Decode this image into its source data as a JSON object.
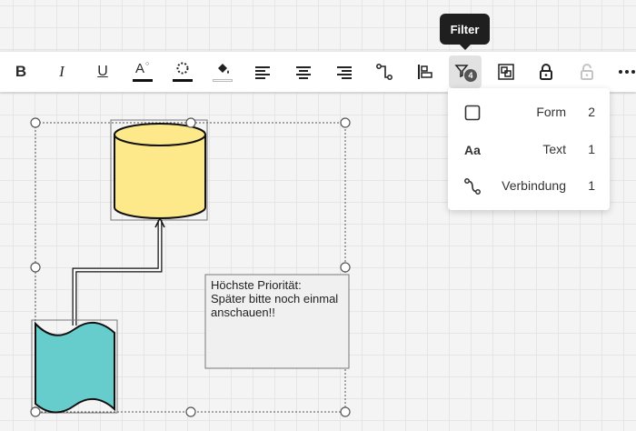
{
  "tooltip": {
    "text": "Filter"
  },
  "toolbar": {
    "buttons": [
      {
        "name": "bold-button",
        "label": "B"
      },
      {
        "name": "italic-button",
        "label": "I"
      },
      {
        "name": "underline-button",
        "label": "U"
      },
      {
        "name": "font-color-button",
        "label": "A"
      },
      {
        "name": "border-color-button",
        "icon": "dotted-circle-icon"
      },
      {
        "name": "fill-color-button",
        "icon": "paint-bucket-icon"
      },
      {
        "name": "align-left-button",
        "icon": "align-left-icon"
      },
      {
        "name": "align-center-button",
        "icon": "align-center-icon"
      },
      {
        "name": "align-right-button",
        "icon": "align-right-icon"
      },
      {
        "name": "connection-style-button",
        "icon": "connector-icon"
      },
      {
        "name": "arrange-button",
        "icon": "align-objects-icon"
      },
      {
        "name": "filter-button",
        "icon": "filter-icon",
        "badge": "4"
      },
      {
        "name": "group-button",
        "icon": "group-icon"
      },
      {
        "name": "lock-button",
        "icon": "lock-icon"
      },
      {
        "name": "unlock-button",
        "icon": "unlock-icon"
      },
      {
        "name": "more-button",
        "icon": "more-icon"
      }
    ]
  },
  "filter_menu": {
    "items": [
      {
        "icon": "square-icon",
        "label": "Form",
        "count": "2"
      },
      {
        "icon": "text-aa-icon",
        "glyph": "Aa",
        "label": "Text",
        "count": "1"
      },
      {
        "icon": "connector-icon",
        "label": "Verbindung",
        "count": "1"
      }
    ]
  },
  "note": {
    "text": "Höchste Priorität:\nSpäter bitte noch einmal anschauen!!"
  },
  "colors": {
    "database_fill": "#fde98a",
    "document_fill": "#66cccc",
    "note_fill": "#f0f0f0",
    "tooltip_bg": "#1f1f1f",
    "active_button_bg": "#e2e2e2"
  }
}
